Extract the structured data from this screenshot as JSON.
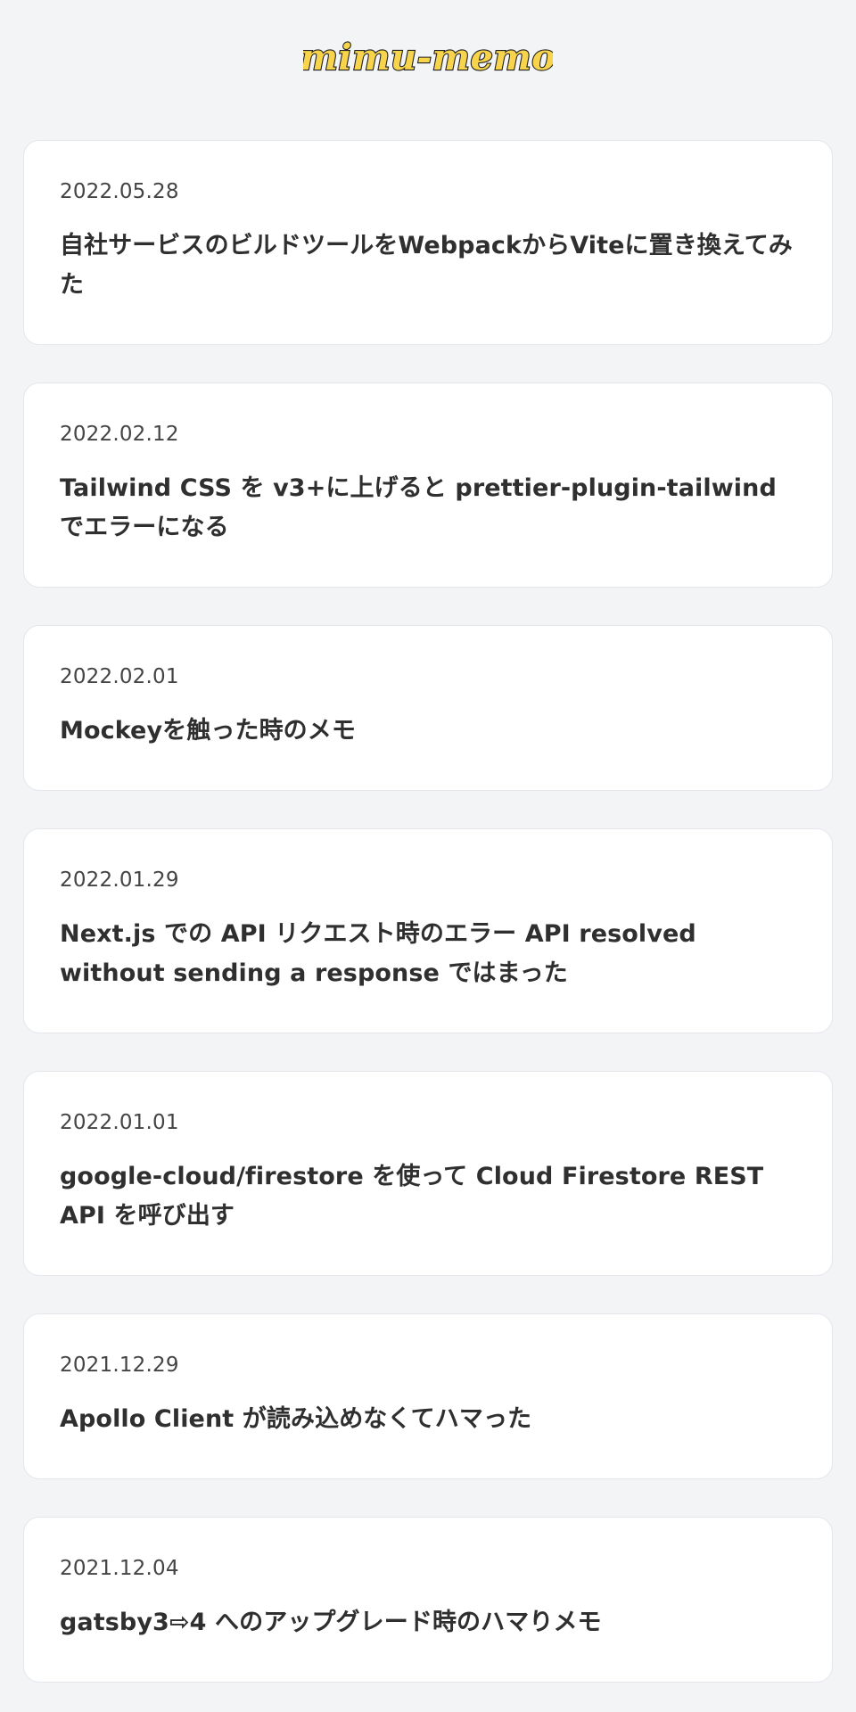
{
  "site": {
    "logo_text": "mimu-memo",
    "brand_color": "#f7d44c",
    "outline_color": "#1f1f1f"
  },
  "posts": [
    {
      "date": "2022.05.28",
      "title": "自社サービスのビルドツールをWebpackからViteに置き換えてみた"
    },
    {
      "date": "2022.02.12",
      "title": "Tailwind CSS を v3+に上げると prettier-plugin-tailwind でエラーになる"
    },
    {
      "date": "2022.02.01",
      "title": "Mockeyを触った時のメモ"
    },
    {
      "date": "2022.01.29",
      "title": "Next.js での API リクエスト時のエラー API resolved without sending a response ではまった"
    },
    {
      "date": "2022.01.01",
      "title": "google-cloud/firestore を使って Cloud Firestore REST API を呼び出す"
    },
    {
      "date": "2021.12.29",
      "title": "Apollo Client が読み込めなくてハマった"
    },
    {
      "date": "2021.12.04",
      "title": "gatsby3⇨4 へのアップグレード時のハマりメモ"
    }
  ]
}
